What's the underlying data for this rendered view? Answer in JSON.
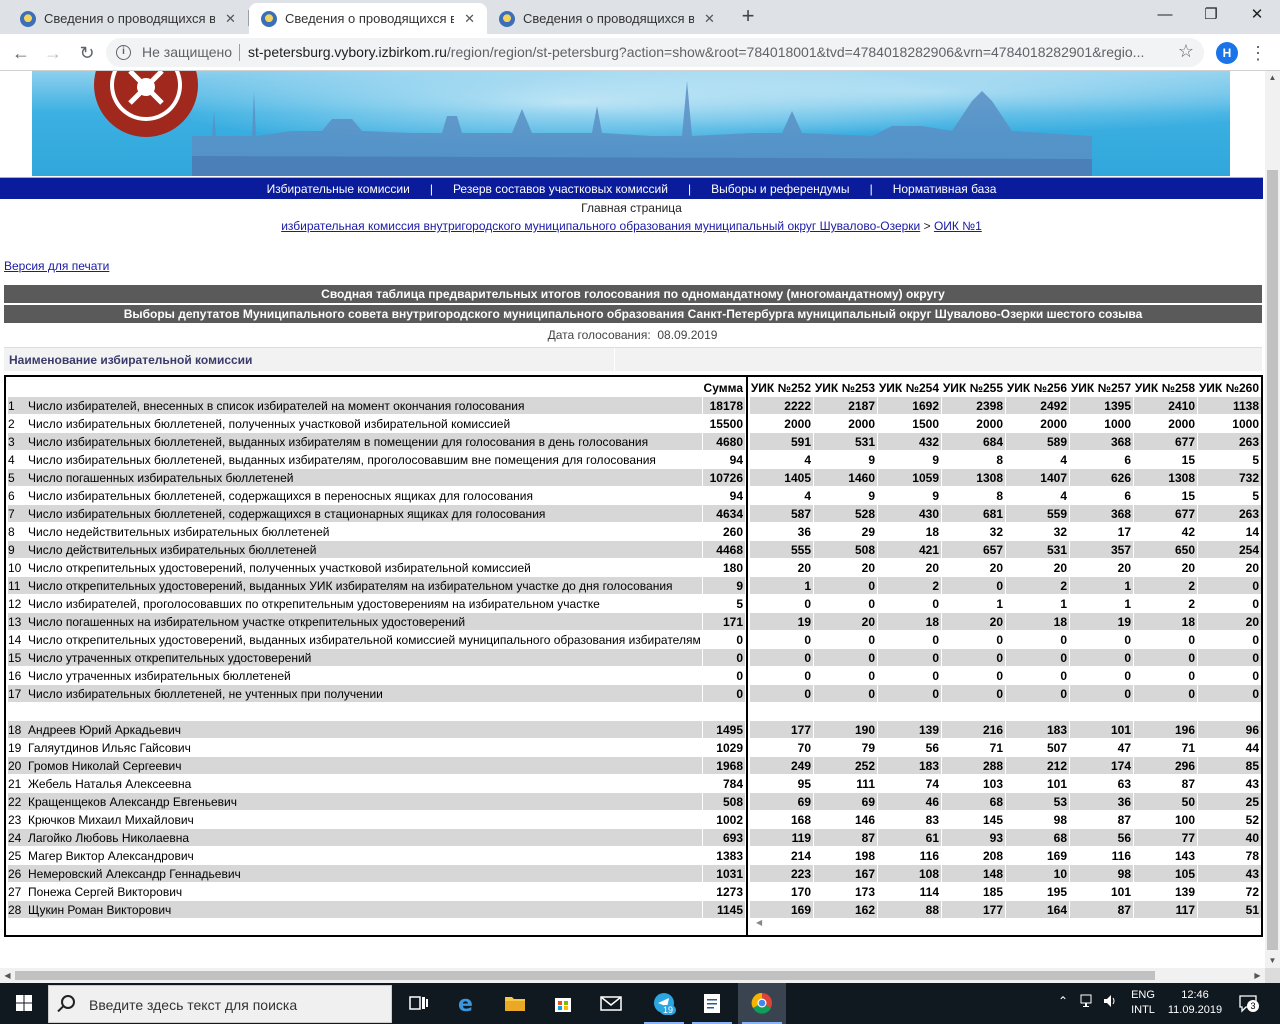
{
  "browser": {
    "tabs": [
      {
        "title": "Сведения о проводящихся выб"
      },
      {
        "title": "Сведения о проводящихся выб"
      },
      {
        "title": "Сведения о проводящихся выб"
      }
    ],
    "new_tab": "+",
    "security": "Не защищено",
    "url_host": "st-petersburg.vybory.izbirkom.ru",
    "url_rest": "/region/region/st-petersburg?action=show&root=784018001&tvd=4784018282906&vrn=4784018282901&regio...",
    "profile_initial": "H"
  },
  "nav": {
    "items": [
      "Избирательные комиссии",
      "Резерв составов участковых комиссий",
      "Выборы и референдумы",
      "Нормативная база"
    ],
    "separator": "|"
  },
  "breadcrumb": {
    "home": "Главная страница",
    "level1": "избирательная комиссия внутригородского муниципального образования муниципальный округ Шувалово-Озерки",
    "arrow": ">",
    "level2": "ОИК №1"
  },
  "print_link": "Версия для печати",
  "report": {
    "title1": "Сводная таблица предварительных итогов голосования по одномандатному (многомандатному) округу",
    "title2": "Выборы депутатов Муниципального совета внутригородского муниципального образования Санкт-Петербурга муниципальный округ Шувалово-Озерки шестого созыва",
    "date_label": "Дата голосования:",
    "date_value": "08.09.2019",
    "name_header": "Наименование избирательной комиссии"
  },
  "table": {
    "sum_header": "Сумма",
    "uik_headers": [
      "УИК №252",
      "УИК №253",
      "УИК №254",
      "УИК №255",
      "УИК №256",
      "УИК №257",
      "УИК №258",
      "УИК №260"
    ],
    "rows": [
      {
        "n": "1",
        "name": "Число избирателей, внесенных в список избирателей на момент окончания голосования",
        "sum": "18178",
        "vals": [
          "2222",
          "2187",
          "1692",
          "2398",
          "2492",
          "1395",
          "2410",
          "1138"
        ]
      },
      {
        "n": "2",
        "name": "Число избирательных бюллетеней, полученных участковой избирательной комиссией",
        "sum": "15500",
        "vals": [
          "2000",
          "2000",
          "1500",
          "2000",
          "2000",
          "1000",
          "2000",
          "1000"
        ]
      },
      {
        "n": "3",
        "name": "Число избирательных бюллетеней, выданных избирателям в помещении для голосования в день голосования",
        "sum": "4680",
        "vals": [
          "591",
          "531",
          "432",
          "684",
          "589",
          "368",
          "677",
          "263"
        ]
      },
      {
        "n": "4",
        "name": "Число избирательных бюллетеней, выданных избирателям, проголосовавшим вне помещения для голосования",
        "sum": "94",
        "vals": [
          "4",
          "9",
          "9",
          "8",
          "4",
          "6",
          "15",
          "5"
        ]
      },
      {
        "n": "5",
        "name": "Число погашенных избирательных бюллетеней",
        "sum": "10726",
        "vals": [
          "1405",
          "1460",
          "1059",
          "1308",
          "1407",
          "626",
          "1308",
          "732"
        ]
      },
      {
        "n": "6",
        "name": "Число избирательных бюллетеней, содержащихся в переносных ящиках для голосования",
        "sum": "94",
        "vals": [
          "4",
          "9",
          "9",
          "8",
          "4",
          "6",
          "15",
          "5"
        ]
      },
      {
        "n": "7",
        "name": "Число избирательных бюллетеней, содержащихся в стационарных ящиках для голосования",
        "sum": "4634",
        "vals": [
          "587",
          "528",
          "430",
          "681",
          "559",
          "368",
          "677",
          "263"
        ]
      },
      {
        "n": "8",
        "name": "Число недействительных избирательных бюллетеней",
        "sum": "260",
        "vals": [
          "36",
          "29",
          "18",
          "32",
          "32",
          "17",
          "42",
          "14"
        ]
      },
      {
        "n": "9",
        "name": "Число действительных избирательных бюллетеней",
        "sum": "4468",
        "vals": [
          "555",
          "508",
          "421",
          "657",
          "531",
          "357",
          "650",
          "254"
        ]
      },
      {
        "n": "10",
        "name": "Число открепительных удостоверений, полученных участковой избирательной комиссией",
        "sum": "180",
        "vals": [
          "20",
          "20",
          "20",
          "20",
          "20",
          "20",
          "20",
          "20"
        ]
      },
      {
        "n": "11",
        "name": "Число открепительных удостоверений, выданных УИК избирателям на избирательном участке до дня голосования",
        "sum": "9",
        "vals": [
          "1",
          "0",
          "2",
          "0",
          "2",
          "1",
          "2",
          "0"
        ]
      },
      {
        "n": "12",
        "name": "Число избирателей, проголосовавших по открепительным удостоверениям на избирательном участке",
        "sum": "5",
        "vals": [
          "0",
          "0",
          "0",
          "1",
          "1",
          "1",
          "2",
          "0"
        ]
      },
      {
        "n": "13",
        "name": "Число погашенных на избирательном участке открепительных удостоверений",
        "sum": "171",
        "vals": [
          "19",
          "20",
          "18",
          "20",
          "18",
          "19",
          "18",
          "20"
        ]
      },
      {
        "n": "14",
        "name": "Число открепительных удостоверений, выданных избирательной комиссией муниципального образования избирателям",
        "sum": "0",
        "vals": [
          "0",
          "0",
          "0",
          "0",
          "0",
          "0",
          "0",
          "0"
        ]
      },
      {
        "n": "15",
        "name": "Число утраченных открепительных удостоверений",
        "sum": "0",
        "vals": [
          "0",
          "0",
          "0",
          "0",
          "0",
          "0",
          "0",
          "0"
        ]
      },
      {
        "n": "16",
        "name": "Число утраченных избирательных бюллетеней",
        "sum": "0",
        "vals": [
          "0",
          "0",
          "0",
          "0",
          "0",
          "0",
          "0",
          "0"
        ]
      },
      {
        "n": "17",
        "name": "Число избирательных бюллетеней, не учтенных при получении",
        "sum": "0",
        "vals": [
          "0",
          "0",
          "0",
          "0",
          "0",
          "0",
          "0",
          "0"
        ]
      }
    ],
    "candidates": [
      {
        "n": "18",
        "name": "Андреев Юрий Аркадьевич",
        "sum": "1495",
        "vals": [
          "177",
          "190",
          "139",
          "216",
          "183",
          "101",
          "196",
          "96"
        ]
      },
      {
        "n": "19",
        "name": "Галяутдинов Ильяс Гайсович",
        "sum": "1029",
        "vals": [
          "70",
          "79",
          "56",
          "71",
          "507",
          "47",
          "71",
          "44"
        ]
      },
      {
        "n": "20",
        "name": "Громов Николай Сергеевич",
        "sum": "1968",
        "vals": [
          "249",
          "252",
          "183",
          "288",
          "212",
          "174",
          "296",
          "85"
        ]
      },
      {
        "n": "21",
        "name": "Жебель Наталья Алексеевна",
        "sum": "784",
        "vals": [
          "95",
          "111",
          "74",
          "103",
          "101",
          "63",
          "87",
          "43"
        ]
      },
      {
        "n": "22",
        "name": "Кращенщеков Александр Евгеньевич",
        "sum": "508",
        "vals": [
          "69",
          "69",
          "46",
          "68",
          "53",
          "36",
          "50",
          "25"
        ]
      },
      {
        "n": "23",
        "name": "Крючков Михаил Михайлович",
        "sum": "1002",
        "vals": [
          "168",
          "146",
          "83",
          "145",
          "98",
          "87",
          "100",
          "52"
        ]
      },
      {
        "n": "24",
        "name": "Лагойко Любовь Николаевна",
        "sum": "693",
        "vals": [
          "119",
          "87",
          "61",
          "93",
          "68",
          "56",
          "77",
          "40"
        ]
      },
      {
        "n": "25",
        "name": "Магер Виктор Александрович",
        "sum": "1383",
        "vals": [
          "214",
          "198",
          "116",
          "208",
          "169",
          "116",
          "143",
          "78"
        ]
      },
      {
        "n": "26",
        "name": "Немеровский Александр Геннадьевич",
        "sum": "1031",
        "vals": [
          "223",
          "167",
          "108",
          "148",
          "10",
          "98",
          "105",
          "43"
        ]
      },
      {
        "n": "27",
        "name": "Понежа Сергей Викторович",
        "sum": "1273",
        "vals": [
          "170",
          "173",
          "114",
          "185",
          "195",
          "101",
          "139",
          "72"
        ]
      },
      {
        "n": "28",
        "name": "Щукин Роман Викторович",
        "sum": "1145",
        "vals": [
          "169",
          "162",
          "88",
          "177",
          "164",
          "87",
          "117",
          "51"
        ]
      }
    ]
  },
  "taskbar": {
    "search_placeholder": "Введите здесь текст для поиска",
    "telegram_badge": "19",
    "lang_top": "ENG",
    "lang_bottom": "INTL",
    "time": "12:46",
    "date": "11.09.2019",
    "notif_count": "3"
  },
  "colors": {
    "navbar": "#0a1b9b",
    "header_bar": "#5a5a5a",
    "row_shade": "#d7d7d7",
    "link": "#1a1aa6"
  }
}
